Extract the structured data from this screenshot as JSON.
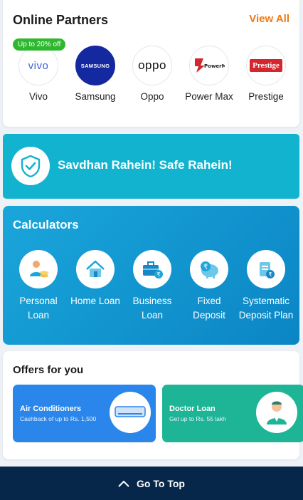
{
  "partners": {
    "title": "Online Partners",
    "view_all": "View All",
    "badge": "Up to 20% off",
    "items": [
      {
        "name": "Vivo",
        "logo_text": "vivo",
        "icon": "vivo-logo-icon"
      },
      {
        "name": "Samsung",
        "logo_text": "SAMSUNG",
        "icon": "samsung-logo-icon"
      },
      {
        "name": "Oppo",
        "logo_text": "oppo",
        "icon": "oppo-logo-icon"
      },
      {
        "name": "Power Max",
        "logo_text": "PowerMax",
        "icon": "powermax-logo-icon"
      },
      {
        "name": "Prestige",
        "logo_text": "Prestige",
        "icon": "prestige-logo-icon"
      }
    ]
  },
  "safe_banner": {
    "text": "Savdhan Rahein! Safe Rahein!",
    "icon": "shield-check-icon"
  },
  "calculators": {
    "title": "Calculators",
    "items": [
      {
        "label": "Personal Loan",
        "icon": "personal-loan-icon"
      },
      {
        "label": "Home Loan",
        "icon": "home-loan-icon"
      },
      {
        "label": "Business Loan",
        "icon": "business-loan-icon"
      },
      {
        "label": "Fixed Deposit",
        "icon": "fixed-deposit-icon"
      },
      {
        "label": "Systematic Deposit Plan",
        "icon": "systematic-deposit-icon"
      }
    ]
  },
  "offers": {
    "title": "Offers for you",
    "items": [
      {
        "title": "Air Conditioners",
        "subtitle": "Cashback of up to Rs. 1,500",
        "icon": "air-conditioner-icon"
      },
      {
        "title": "Doctor Loan",
        "subtitle": "Get up to Rs. 55 lakh",
        "icon": "doctor-icon"
      }
    ]
  },
  "footer": {
    "go_top": "Go To Top",
    "icon": "chevron-up-icon"
  },
  "colors": {
    "accent": "#ee7a16",
    "banner": "#12b3cf",
    "calc": "#1aa6db",
    "footer": "#06264a",
    "badge": "#2eb82e"
  }
}
